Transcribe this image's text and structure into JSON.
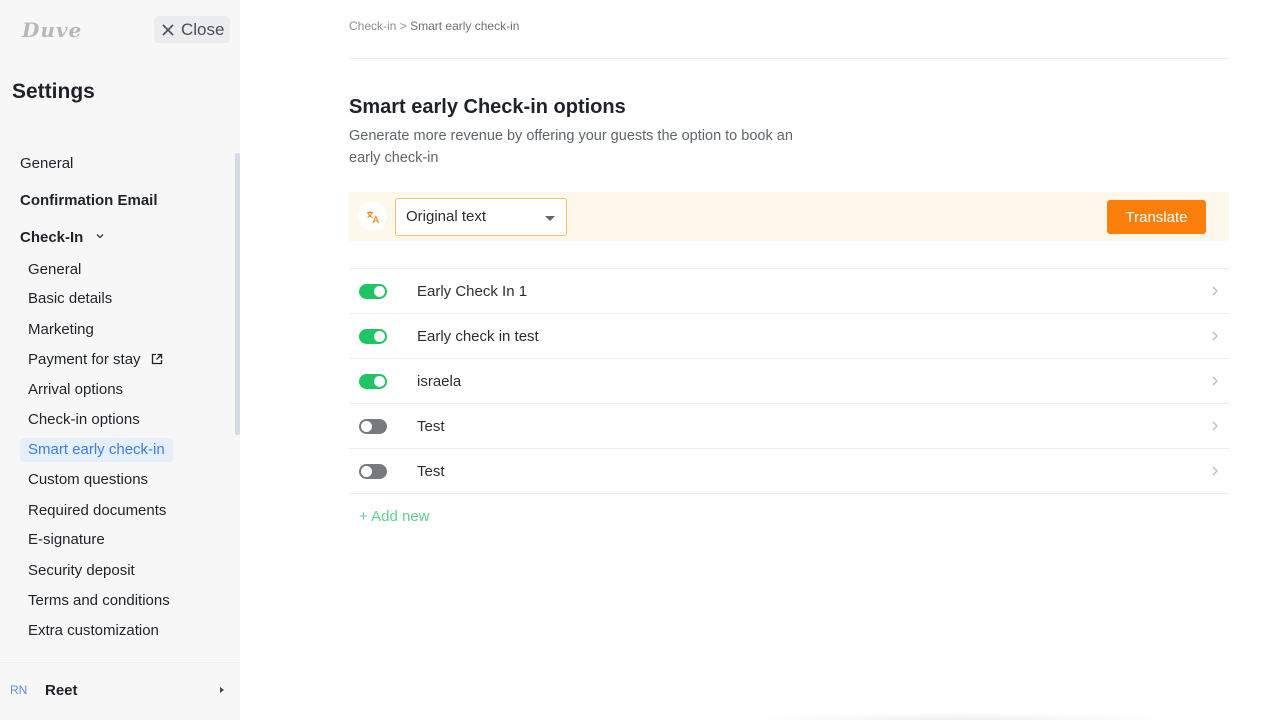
{
  "app": {
    "logo_text": "Duve",
    "close_label": "Close"
  },
  "sidebar": {
    "title": "Settings",
    "top_items": [
      {
        "label": "General"
      },
      {
        "label": "Confirmation Email"
      },
      {
        "label": "Check-In",
        "expanded": true
      }
    ],
    "sub_items": [
      {
        "label": "General"
      },
      {
        "label": "Basic details"
      },
      {
        "label": "Marketing"
      },
      {
        "label": "Payment for stay",
        "external": true
      },
      {
        "label": "Arrival options"
      },
      {
        "label": "Check-in options"
      },
      {
        "label": "Smart early check-in",
        "active": true
      },
      {
        "label": "Custom questions"
      },
      {
        "label": "Required documents"
      },
      {
        "label": "E-signature"
      },
      {
        "label": "Security deposit"
      },
      {
        "label": "Terms and conditions"
      },
      {
        "label": "Extra customization"
      }
    ],
    "user": {
      "initials": "RN",
      "name": "Reet"
    }
  },
  "breadcrumb": {
    "parent": "Check-in",
    "separator": ">",
    "current": "Smart early check-in"
  },
  "page": {
    "title": "Smart early Check-in options",
    "description": "Generate more revenue by offering your guests the option to book an early check-in"
  },
  "translate": {
    "icon": "translate-icon",
    "selected_language": "Original text",
    "button_label": "Translate"
  },
  "options": [
    {
      "label": "Early Check In 1",
      "enabled": true
    },
    {
      "label": "Early check in test",
      "enabled": true
    },
    {
      "label": "israela",
      "enabled": true
    },
    {
      "label": "Test",
      "enabled": false
    },
    {
      "label": "Test",
      "enabled": false
    }
  ],
  "add_new_label": "+ Add new",
  "colors": {
    "accent_orange": "#fb7f0a",
    "toggle_on": "#21c465",
    "toggle_off": "#767a80",
    "active_nav_text": "#3f7ed8",
    "active_nav_bg": "#e5eefb",
    "add_new_green": "#5fcf8e"
  }
}
